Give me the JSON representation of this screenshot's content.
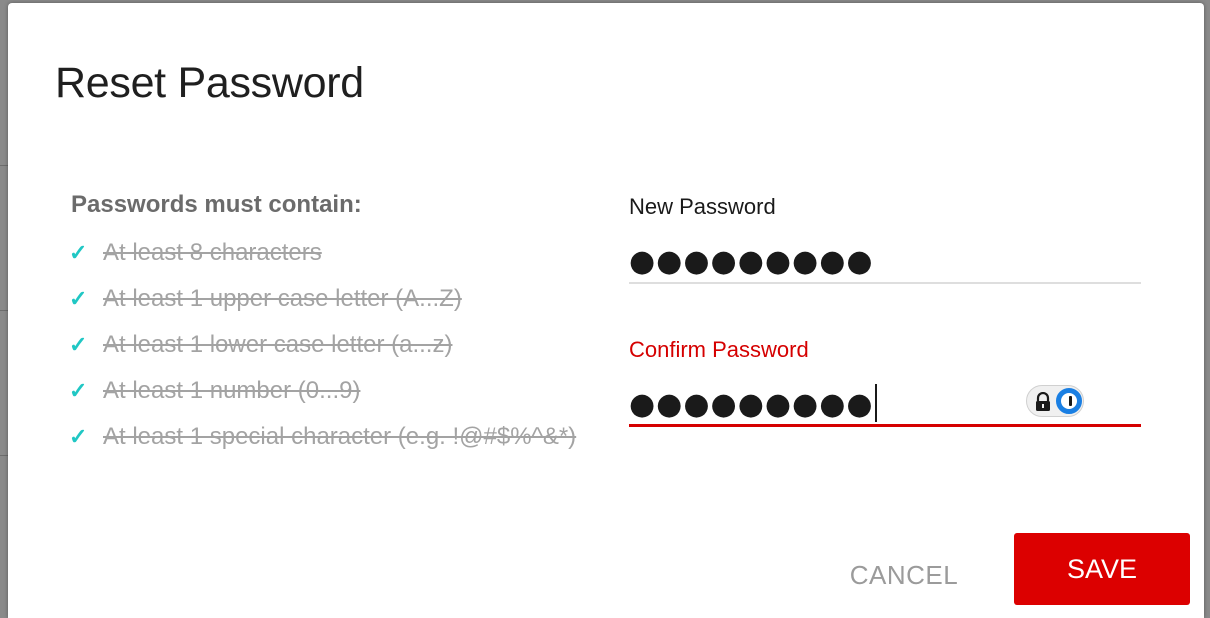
{
  "dialog": {
    "title": "Reset Password"
  },
  "requirements": {
    "heading": "Passwords must contain:",
    "items": [
      {
        "text": "At least 8 characters",
        "satisfied": true
      },
      {
        "text": "At least 1 upper case letter (A...Z)",
        "satisfied": true
      },
      {
        "text": "At least 1 lower case letter (a...z)",
        "satisfied": true
      },
      {
        "text": "At least 1 number (0...9)",
        "satisfied": true
      },
      {
        "text": "At least 1 special character (e.g. !@#$%^&*)",
        "satisfied": true
      }
    ],
    "check_glyph": "✓",
    "check_color": "#20c7c4"
  },
  "form": {
    "new_password": {
      "label": "New Password",
      "masked_value": "●●●●●●●●●"
    },
    "confirm_password": {
      "label": "Confirm Password",
      "masked_value": "●●●●●●●●●",
      "state": "error",
      "error_color": "#d50000",
      "password_manager_icons": [
        "lock-icon",
        "password-manager-icon"
      ]
    }
  },
  "actions": {
    "cancel_label": "CANCEL",
    "save_label": "SAVE",
    "save_color": "#dc0000"
  }
}
